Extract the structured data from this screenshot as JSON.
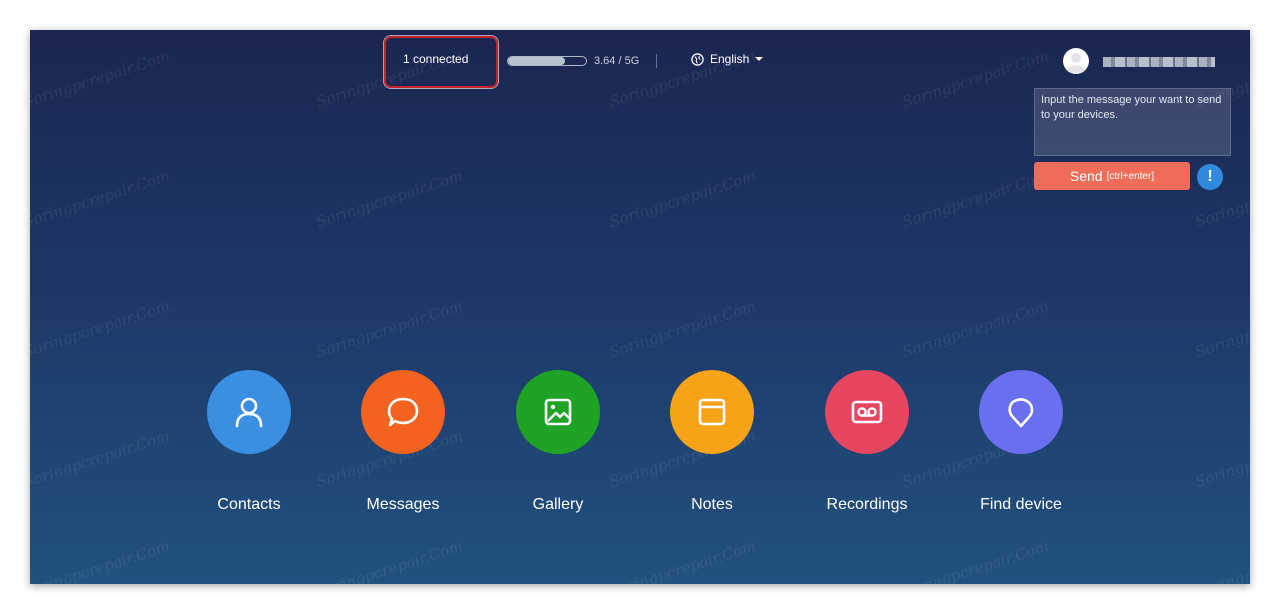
{
  "top_bar": {
    "connected_label": "1 connected",
    "storage": {
      "used_fraction": 0.73,
      "text": "3.64 / 5G"
    },
    "language": "English"
  },
  "message_panel": {
    "placeholder": "Input the message your want to send to your devices.",
    "send_label": "Send",
    "send_hint": "[ctrl+enter]",
    "info_glyph": "!"
  },
  "apps": [
    {
      "label": "Contacts",
      "icon": "person-icon",
      "color": "#3a8fe3"
    },
    {
      "label": "Messages",
      "icon": "chat-bubble-icon",
      "color": "#f4621f"
    },
    {
      "label": "Gallery",
      "icon": "image-icon",
      "color": "#1fa324"
    },
    {
      "label": "Notes",
      "icon": "notes-icon",
      "color": "#f7a317"
    },
    {
      "label": "Recordings",
      "icon": "recording-icon",
      "color": "#e5455e"
    },
    {
      "label": "Find device",
      "icon": "location-pin-icon",
      "color": "#6a6ff0"
    }
  ],
  "watermark": "Soringpcrepair.Com",
  "colors": {
    "highlight_border": "#c8232c",
    "send_button": "#ef6d58",
    "info_button": "#2f8ae0"
  }
}
